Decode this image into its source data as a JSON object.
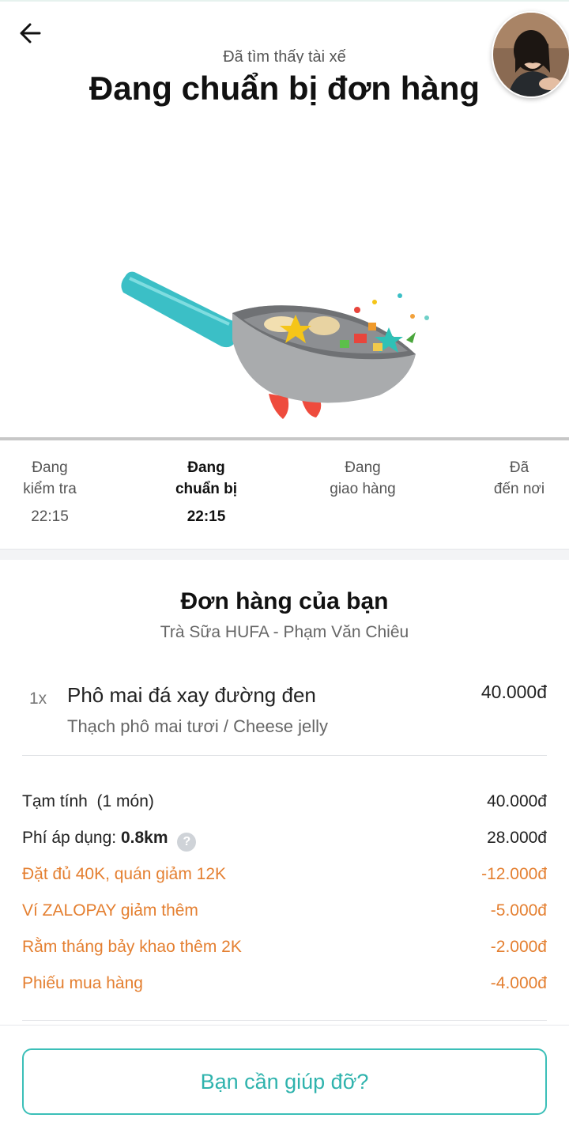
{
  "header": {
    "subtitle": "Đã tìm thấy tài xế",
    "title": "Đang chuẩn bị đơn hàng"
  },
  "steps": [
    {
      "line1": "Đang",
      "line2": "kiểm tra",
      "time": "22:15",
      "active": false
    },
    {
      "line1": "Đang",
      "line2": "chuẩn bị",
      "time": "22:15",
      "active": true
    },
    {
      "line1": "Đang",
      "line2": "giao hàng",
      "time": "",
      "active": false
    },
    {
      "line1": "Đã",
      "line2": "đến nơi",
      "time": "",
      "active": false
    }
  ],
  "order": {
    "title": "Đơn hàng của bạn",
    "shop": "Trà Sữa HUFA - Phạm Văn Chiêu",
    "items": [
      {
        "qty": "1x",
        "name": "Phô mai đá xay đường đen",
        "option": "Thạch phô mai tươi / Cheese jelly",
        "price": "40.000đ"
      }
    ]
  },
  "summary": {
    "subtotal_label": "Tạm tính  (1 món)",
    "subtotal_value": "40.000đ",
    "fee_label": "Phí áp dụng:",
    "fee_distance": "0.8km",
    "fee_help": "?",
    "fee_value": "28.000đ",
    "discounts": [
      {
        "label": "Đặt đủ 40K, quán giảm 12K",
        "value": "-12.000đ"
      },
      {
        "label": "Ví ZALOPAY giảm thêm",
        "value": "-5.000đ"
      },
      {
        "label": "Rằm tháng bảy khao thêm 2K",
        "value": "-2.000đ"
      },
      {
        "label": "Phiếu mua hàng",
        "value": "-4.000đ"
      }
    ]
  },
  "help_button": "Bạn cần giúp đỡ?",
  "colors": {
    "accent": "#2fb3ad",
    "discount": "#e47f30",
    "pan_handle": "#3bbfc6"
  },
  "icons": {
    "back": "back-arrow-icon",
    "avatar": "avatar",
    "illustration": "frying-pan-illustration"
  }
}
